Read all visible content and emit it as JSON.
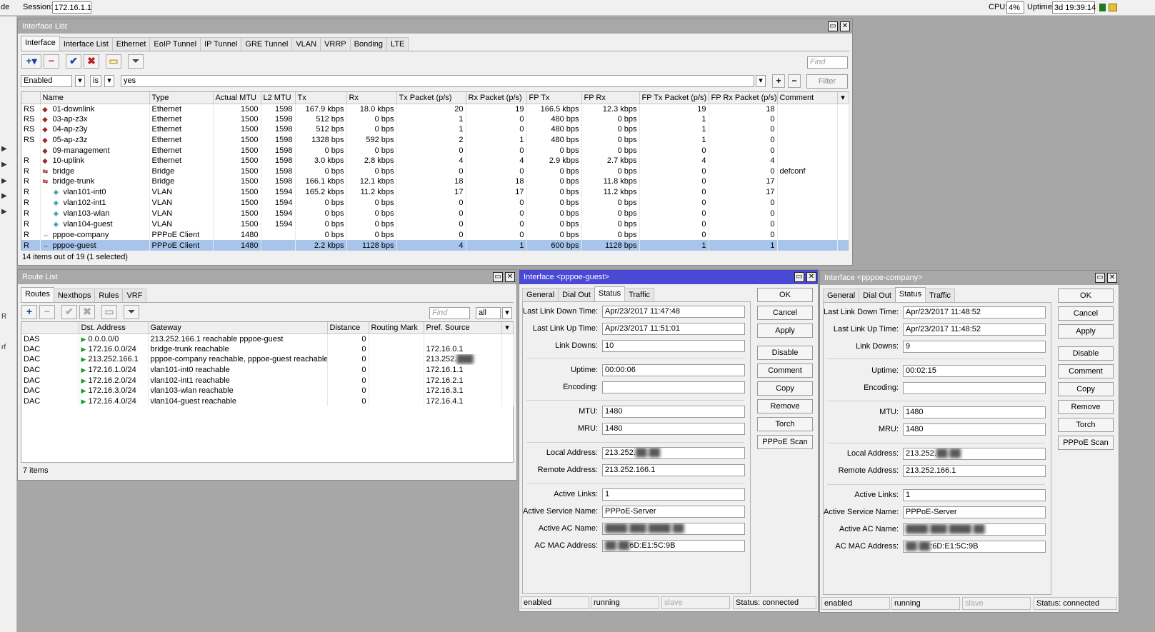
{
  "topbar": {
    "left_stub": "de",
    "session_label": "Session:",
    "session_value": "172.16.1.1",
    "cpu_label": "CPU:",
    "cpu_value": "4%",
    "uptime_label": "Uptime:",
    "uptime_value": "3d 19:39:14"
  },
  "leftstrip": {
    "c1": "rf"
  },
  "iface_list": {
    "title": "Interface List",
    "tabs": [
      "Interface",
      "Interface List",
      "Ethernet",
      "EoIP Tunnel",
      "IP Tunnel",
      "GRE Tunnel",
      "VLAN",
      "VRRP",
      "Bonding",
      "LTE"
    ],
    "find_placeholder": "Find",
    "filter": {
      "field": "Enabled",
      "op": "is",
      "value": "yes",
      "button": "Filter"
    },
    "columns": [
      "",
      "Name",
      "Type",
      "Actual MTU",
      "L2 MTU",
      "Tx",
      "Rx",
      "Tx Packet (p/s)",
      "Rx Packet (p/s)",
      "FP Tx",
      "FP Rx",
      "FP Tx Packet (p/s)",
      "FP Rx Packet (p/s)",
      "Comment"
    ],
    "rows": [
      [
        "RS",
        "01-downlink",
        "Ethernet",
        "1500",
        "1598",
        "167.9 kbps",
        "18.0 kbps",
        "20",
        "19",
        "166.5 kbps",
        "12.3 kbps",
        "19",
        "18",
        ""
      ],
      [
        "RS",
        "03-ap-z3x",
        "Ethernet",
        "1500",
        "1598",
        "512 bps",
        "0 bps",
        "1",
        "0",
        "480 bps",
        "0 bps",
        "1",
        "0",
        ""
      ],
      [
        "RS",
        "04-ap-z3y",
        "Ethernet",
        "1500",
        "1598",
        "512 bps",
        "0 bps",
        "1",
        "0",
        "480 bps",
        "0 bps",
        "1",
        "0",
        ""
      ],
      [
        "RS",
        "05-ap-z3z",
        "Ethernet",
        "1500",
        "1598",
        "1328 bps",
        "592 bps",
        "2",
        "1",
        "480 bps",
        "0 bps",
        "1",
        "0",
        ""
      ],
      [
        "",
        "09-management",
        "Ethernet",
        "1500",
        "1598",
        "0 bps",
        "0 bps",
        "0",
        "0",
        "0 bps",
        "0 bps",
        "0",
        "0",
        ""
      ],
      [
        "R",
        "10-uplink",
        "Ethernet",
        "1500",
        "1598",
        "3.0 kbps",
        "2.8 kbps",
        "4",
        "4",
        "2.9 kbps",
        "2.7 kbps",
        "4",
        "4",
        ""
      ],
      [
        "R",
        "bridge",
        "Bridge",
        "1500",
        "1598",
        "0 bps",
        "0 bps",
        "0",
        "0",
        "0 bps",
        "0 bps",
        "0",
        "0",
        "defconf"
      ],
      [
        "R",
        "bridge-trunk",
        "Bridge",
        "1500",
        "1598",
        "166.1 kbps",
        "12.1 kbps",
        "18",
        "18",
        "0 bps",
        "11.8 kbps",
        "0",
        "17",
        ""
      ],
      [
        "R",
        "vlan101-int0",
        "VLAN",
        "1500",
        "1594",
        "165.2 kbps",
        "11.2 kbps",
        "17",
        "17",
        "0 bps",
        "11.2 kbps",
        "0",
        "17",
        ""
      ],
      [
        "R",
        "vlan102-int1",
        "VLAN",
        "1500",
        "1594",
        "0 bps",
        "0 bps",
        "0",
        "0",
        "0 bps",
        "0 bps",
        "0",
        "0",
        ""
      ],
      [
        "R",
        "vlan103-wlan",
        "VLAN",
        "1500",
        "1594",
        "0 bps",
        "0 bps",
        "0",
        "0",
        "0 bps",
        "0 bps",
        "0",
        "0",
        ""
      ],
      [
        "R",
        "vlan104-guest",
        "VLAN",
        "1500",
        "1594",
        "0 bps",
        "0 bps",
        "0",
        "0",
        "0 bps",
        "0 bps",
        "0",
        "0",
        ""
      ],
      [
        "R",
        "pppoe-company",
        "PPPoE Client",
        "1480",
        "",
        "0 bps",
        "0 bps",
        "0",
        "0",
        "0 bps",
        "0 bps",
        "0",
        "0",
        ""
      ],
      [
        "R",
        "pppoe-guest",
        "PPPoE Client",
        "1480",
        "",
        "2.2 kbps",
        "1128 bps",
        "4",
        "1",
        "600 bps",
        "1128 bps",
        "1",
        "1",
        ""
      ]
    ],
    "row_icons": [
      "eth",
      "eth",
      "eth",
      "eth",
      "eth",
      "eth",
      "br",
      "br",
      "vlan",
      "vlan",
      "vlan",
      "vlan",
      "ppp",
      "ppp"
    ],
    "status": "14 items out of 19 (1 selected)"
  },
  "route_list": {
    "title": "Route List",
    "tabs": [
      "Routes",
      "Nexthops",
      "Rules",
      "VRF"
    ],
    "find_placeholder": "Find",
    "select_value": "all",
    "columns": [
      "",
      "Dst. Address",
      "Gateway",
      "Distance",
      "Routing Mark",
      "Pref. Source"
    ],
    "rows": [
      [
        "DAS",
        "0.0.0.0/0",
        "213.252.166.1 reachable pppoe-guest",
        "0",
        "",
        ""
      ],
      [
        "DAC",
        "172.16.0.0/24",
        "bridge-trunk reachable",
        "0",
        "",
        "172.16.0.1"
      ],
      [
        "DAC",
        "213.252.166.1",
        "pppoe-company reachable, pppoe-guest reachable",
        "0",
        "",
        "213.252."
      ],
      [
        "DAC",
        "172.16.1.0/24",
        "vlan101-int0 reachable",
        "0",
        "",
        "172.16.1.1"
      ],
      [
        "DAC",
        "172.16.2.0/24",
        "vlan102-int1 reachable",
        "0",
        "",
        "172.16.2.1"
      ],
      [
        "DAC",
        "172.16.3.0/24",
        "vlan103-wlan reachable",
        "0",
        "",
        "172.16.3.1"
      ],
      [
        "DAC",
        "172.16.4.0/24",
        "vlan104-guest reachable",
        "0",
        "",
        "172.16.4.1"
      ]
    ],
    "status": "7 items"
  },
  "guest": {
    "title": "Interface <pppoe-guest>",
    "tabs": [
      "General",
      "Dial Out",
      "Status",
      "Traffic"
    ],
    "fields": {
      "last_link_down_label": "Last Link Down Time:",
      "last_link_down": "Apr/23/2017 11:47:48",
      "last_link_up_label": "Last Link Up Time:",
      "last_link_up": "Apr/23/2017 11:51:01",
      "link_downs_label": "Link Downs:",
      "link_downs": "10",
      "uptime_label": "Uptime:",
      "uptime": "00:00:06",
      "encoding_label": "Encoding:",
      "encoding": "",
      "mtu_label": "MTU:",
      "mtu": "1480",
      "mru_label": "MRU:",
      "mru": "1480",
      "local_label": "Local Address:",
      "local": "213.252.",
      "remote_label": "Remote Address:",
      "remote": "213.252.166.1",
      "links_label": "Active Links:",
      "links": "1",
      "service_label": "Active Service Name:",
      "service": "PPPoE-Server",
      "ac_label": "Active AC Name:",
      "ac": "",
      "mac_label": "AC MAC Address:",
      "mac": "6D:E1:5C:9B"
    },
    "buttons": [
      "OK",
      "Cancel",
      "Apply",
      "Disable",
      "Comment",
      "Copy",
      "Remove",
      "Torch",
      "PPPoE Scan"
    ],
    "statusbar": [
      "enabled",
      "running",
      "slave",
      "Status: connected"
    ]
  },
  "company": {
    "title": "Interface <pppoe-company>",
    "tabs": [
      "General",
      "Dial Out",
      "Status",
      "Traffic"
    ],
    "fields": {
      "last_link_down_label": "Last Link Down Time:",
      "last_link_down": "Apr/23/2017 11:48:52",
      "last_link_up_label": "Last Link Up Time:",
      "last_link_up": "Apr/23/2017 11:48:52",
      "link_downs_label": "Link Downs:",
      "link_downs": "9",
      "uptime_label": "Uptime:",
      "uptime": "00:02:15",
      "encoding_label": "Encoding:",
      "encoding": "",
      "mtu_label": "MTU:",
      "mtu": "1480",
      "mru_label": "MRU:",
      "mru": "1480",
      "local_label": "Local Address:",
      "local": "213.252.",
      "remote_label": "Remote Address:",
      "remote": "213.252.166.1",
      "links_label": "Active Links:",
      "links": "1",
      "service_label": "Active Service Name:",
      "service": "PPPoE-Server",
      "ac_label": "Active AC Name:",
      "ac": "",
      "mac_label": "AC MAC Address:",
      "mac": ":6D:E1:5C:9B"
    },
    "buttons": [
      "OK",
      "Cancel",
      "Apply",
      "Disable",
      "Comment",
      "Copy",
      "Remove",
      "Torch",
      "PPPoE Scan"
    ],
    "statusbar": [
      "enabled",
      "running",
      "slave",
      "Status: connected"
    ]
  },
  "colors": {
    "active_title": "#4a49d6",
    "inactive_title": "#a8a8a8",
    "selected_row": "#a7c4ea",
    "background": "#a7a7a7"
  }
}
